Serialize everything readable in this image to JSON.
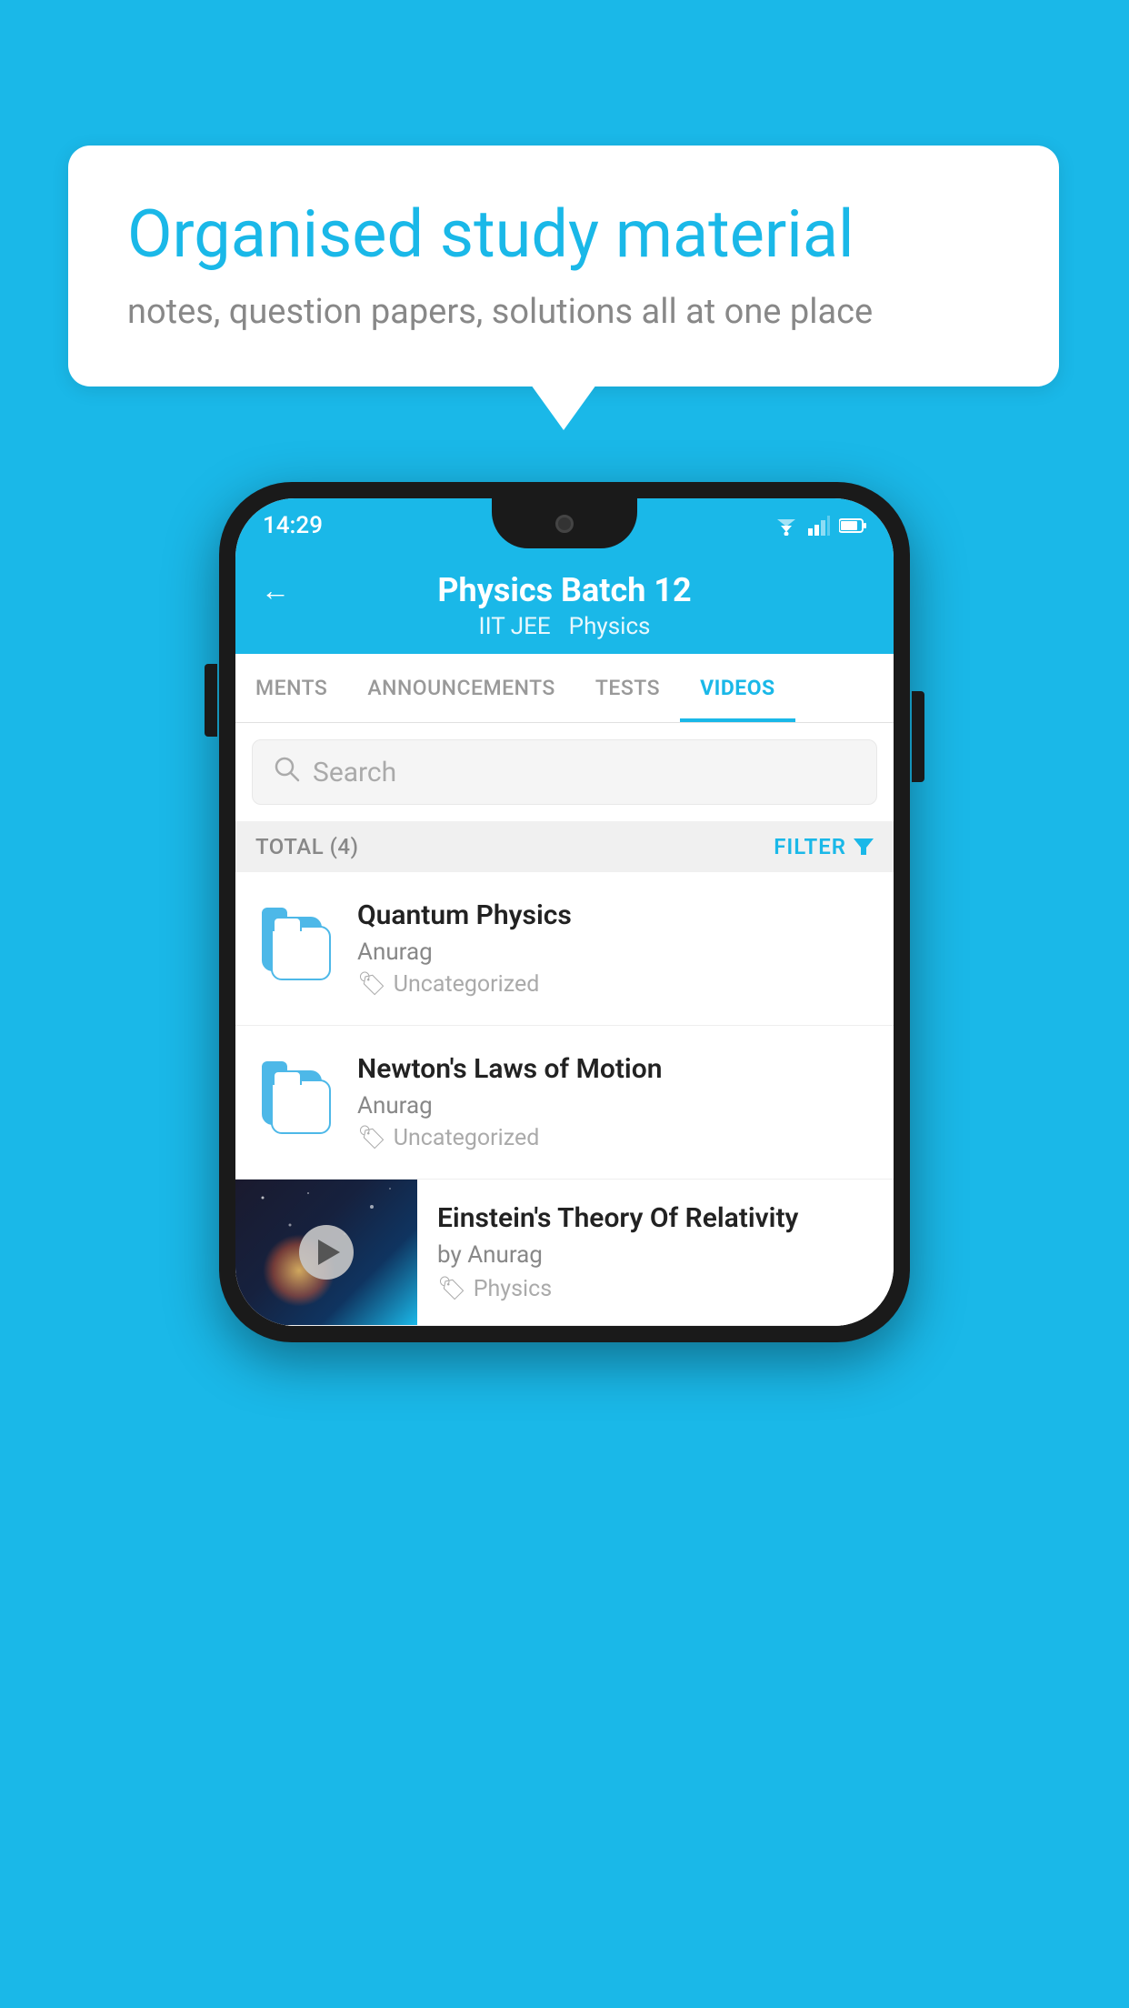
{
  "background": {
    "color": "#1ab8e8"
  },
  "speech_bubble": {
    "title": "Organised study material",
    "subtitle": "notes, question papers, solutions all at one place"
  },
  "phone": {
    "status_bar": {
      "time": "14:29"
    },
    "header": {
      "title": "Physics Batch 12",
      "subtitle1": "IIT JEE",
      "subtitle2": "Physics",
      "back_label": "←"
    },
    "tabs": [
      {
        "label": "MENTS",
        "active": false
      },
      {
        "label": "ANNOUNCEMENTS",
        "active": false
      },
      {
        "label": "TESTS",
        "active": false
      },
      {
        "label": "VIDEOS",
        "active": true
      }
    ],
    "search": {
      "placeholder": "Search"
    },
    "filter_bar": {
      "total_label": "TOTAL (4)",
      "filter_label": "FILTER"
    },
    "videos": [
      {
        "title": "Quantum Physics",
        "author": "Anurag",
        "tag": "Uncategorized",
        "has_thumbnail": false
      },
      {
        "title": "Newton's Laws of Motion",
        "author": "Anurag",
        "tag": "Uncategorized",
        "has_thumbnail": false
      },
      {
        "title": "Einstein's Theory Of Relativity",
        "author": "by Anurag",
        "tag": "Physics",
        "has_thumbnail": true
      }
    ]
  }
}
